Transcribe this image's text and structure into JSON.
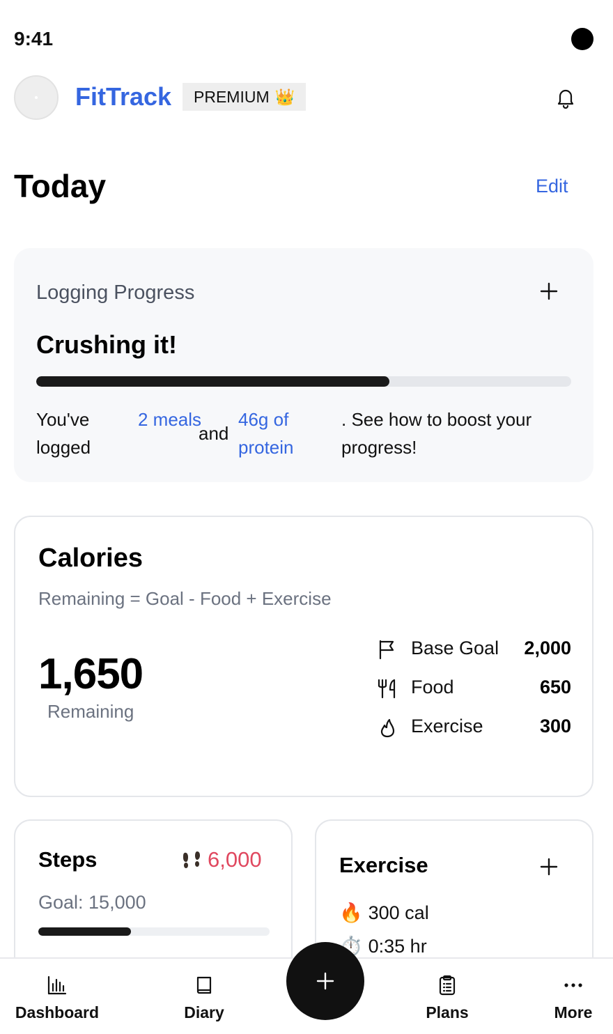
{
  "status_bar": {
    "time": "9:41"
  },
  "header": {
    "brand": "FitTrack",
    "premium_label": "PREMIUM",
    "premium_emoji": "👑",
    "bell_icon": "bell-icon"
  },
  "today": {
    "title": "Today",
    "edit_label": "Edit"
  },
  "logging_progress": {
    "label": "Logging Progress",
    "headline": "Crushing it!",
    "progress_percent": 66,
    "sentence": {
      "part1": "You've logged",
      "meals_link": "2 meals",
      "part2": "and",
      "protein_link": "46g of protein",
      "part3": ". See how to boost your progress!"
    }
  },
  "calories": {
    "title": "Calories",
    "subtitle": "Remaining = Goal - Food + Exercise",
    "remaining_value": "1,650",
    "remaining_label": "Remaining",
    "rows": [
      {
        "icon": "flag-icon",
        "label": "Base Goal",
        "value": "2,000"
      },
      {
        "icon": "fork-knife-icon",
        "label": "Food",
        "value": "650"
      },
      {
        "icon": "flame-icon",
        "label": "Exercise",
        "value": "300"
      }
    ]
  },
  "steps": {
    "title": "Steps",
    "value": "6,000",
    "goal": "Goal: 15,000",
    "progress_percent": 40,
    "value_color": "#e0485f"
  },
  "exercise": {
    "title": "Exercise",
    "calories_emoji": "🔥",
    "calories": "300 cal",
    "duration_emoji": "⏱️",
    "duration": "0:35 hr"
  },
  "bottom_nav": {
    "items": [
      {
        "label": "Dashboard",
        "icon": "bar-chart-icon"
      },
      {
        "label": "Diary",
        "icon": "book-icon"
      },
      {
        "label": "Plans",
        "icon": "clipboard-icon"
      },
      {
        "label": "More",
        "icon": "more-dots-icon"
      }
    ],
    "fab_icon": "plus-icon"
  },
  "colors": {
    "accent": "#3566e0",
    "text": "#111111",
    "muted": "#6b7280",
    "card_bg": "#f7f8fa",
    "progress_fill": "#1a1a1a"
  }
}
